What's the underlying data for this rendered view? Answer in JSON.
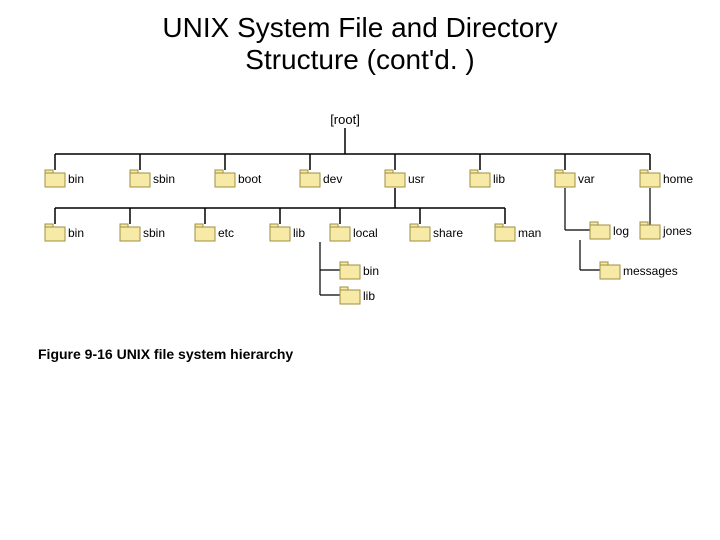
{
  "title_line1": "UNIX System File and Directory",
  "title_line2": "Structure (cont'd. )",
  "caption": "Figure 9-16 UNIX file system hierarchy",
  "root_label": "[root]",
  "level1": {
    "n0": "bin",
    "n1": "sbin",
    "n2": "boot",
    "n3": "dev",
    "n4": "usr",
    "n5": "lib",
    "n6": "var",
    "n7": "home"
  },
  "level2_usr": {
    "n0": "bin",
    "n1": "sbin",
    "n2": "etc",
    "n3": "lib",
    "n4": "local",
    "n5": "share",
    "n6": "man"
  },
  "level2_var": {
    "n0": "log"
  },
  "level2_home": {
    "n0": "jones"
  },
  "level3_local": {
    "n0": "bin",
    "n1": "lib"
  },
  "level3_log": {
    "n0": "messages"
  }
}
